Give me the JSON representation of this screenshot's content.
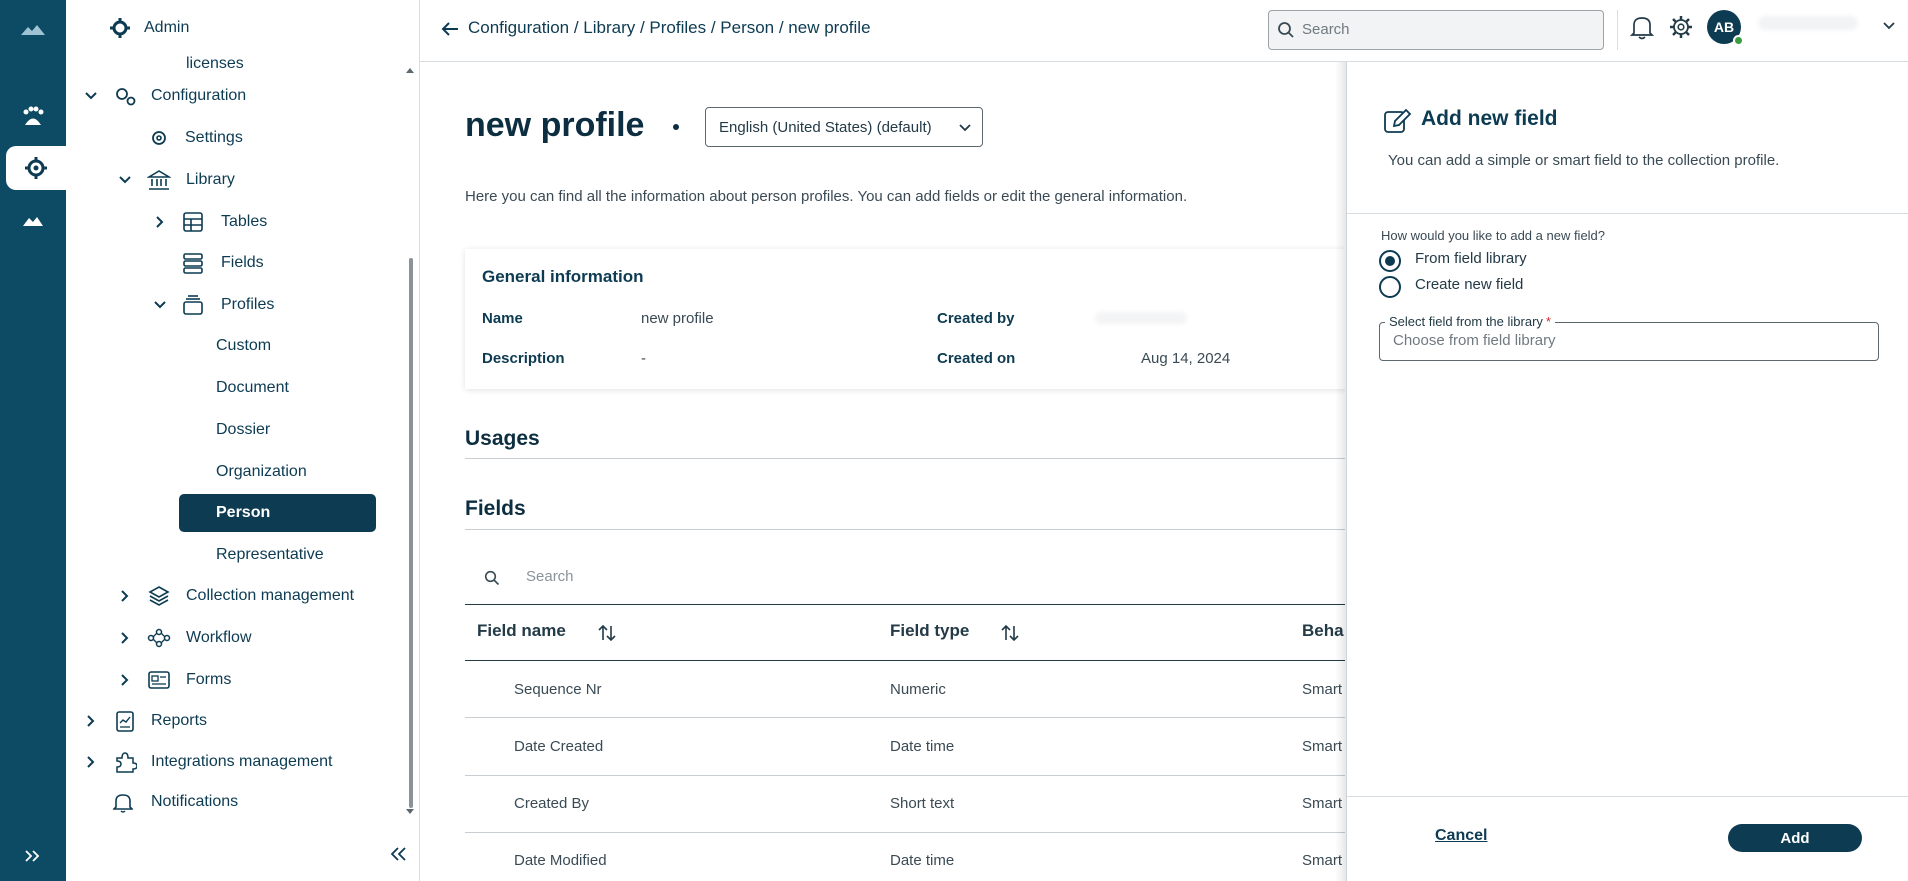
{
  "rail": {
    "items": [
      {
        "icon": "logo-icon"
      },
      {
        "icon": "pets-icon"
      },
      {
        "icon": "gear-cluster-icon"
      },
      {
        "icon": "cloud-icon"
      },
      {
        "icon": "expand-double-chevron-icon"
      }
    ]
  },
  "sidebar": {
    "admin_label": "Admin",
    "licenses_label": "licenses",
    "configuration_label": "Configuration",
    "settings_label": "Settings",
    "library_label": "Library",
    "tables_label": "Tables",
    "fields_label": "Fields",
    "profiles_label": "Profiles",
    "profile_items": [
      "Custom",
      "Document",
      "Dossier",
      "Organization",
      "Person",
      "Representative"
    ],
    "collection_management_label": "Collection management",
    "workflow_label": "Workflow",
    "forms_label": "Forms",
    "reports_label": "Reports",
    "integrations_label": "Integrations management",
    "notifications_label": "Notifications",
    "active_item": "Person"
  },
  "header": {
    "breadcrumb": "Configuration / Library / Profiles / Person / new profile",
    "search_placeholder": "Search",
    "avatar_initials": "AB"
  },
  "main": {
    "title": "new profile",
    "language_select": "English (United States) (default)",
    "description": "Here you can find all the information about person profiles. You can add fields or edit the general information.",
    "general_info": {
      "title": "General information",
      "name_label": "Name",
      "name_value": "new profile",
      "description_label": "Description",
      "description_value": "-",
      "created_by_label": "Created by",
      "created_on_label": "Created on",
      "created_on_value": "Aug 14, 2024"
    },
    "usages_title": "Usages",
    "fields_title": "Fields",
    "fields_search_placeholder": "Search",
    "table": {
      "headers": [
        "Field name",
        "Field type",
        "Beha"
      ],
      "rows": [
        {
          "name": "Sequence Nr",
          "type": "Numeric",
          "behavior": "Smart"
        },
        {
          "name": "Date Created",
          "type": "Date time",
          "behavior": "Smart"
        },
        {
          "name": "Created By",
          "type": "Short text",
          "behavior": "Smart"
        },
        {
          "name": "Date Modified",
          "type": "Date time",
          "behavior": "Smart"
        }
      ]
    }
  },
  "panel": {
    "title": "Add new field",
    "subtitle": "You can add a simple or smart field to the collection profile.",
    "question": "How would you like to add a new field?",
    "options": [
      {
        "label": "From field library",
        "selected": true
      },
      {
        "label": "Create new field",
        "selected": false
      }
    ],
    "select_label": "Select field from the library",
    "required_mark": "*",
    "select_placeholder": "Choose from field library",
    "cancel_label": "Cancel",
    "add_label": "Add"
  },
  "colors": {
    "rail": "#0d4a63",
    "primary": "#0d3b52",
    "required": "#d2282e",
    "online": "#3d9b3f"
  }
}
